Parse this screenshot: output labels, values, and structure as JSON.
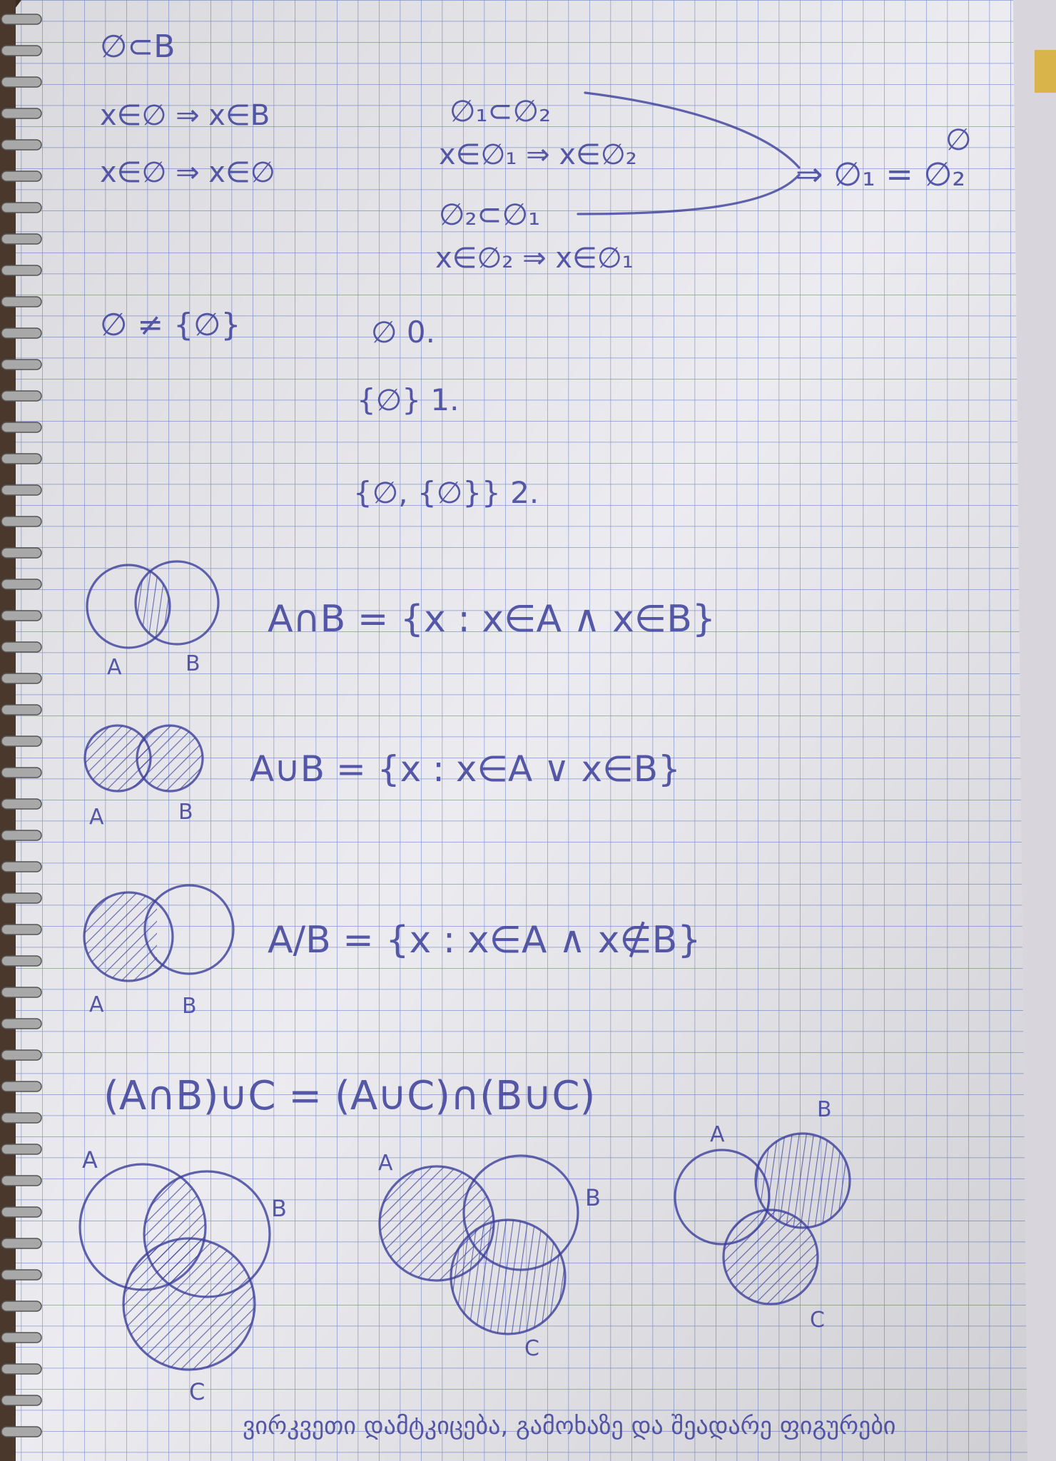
{
  "colors": {
    "paper": "#ecebf0",
    "grid": "#5a78c8",
    "ink": "#3c3f9a",
    "background": "#3a2a20",
    "binding": "#9a9a9a"
  },
  "notes": {
    "line1": "∅⊂B",
    "line2": "x∈∅ ⇒ x∈B",
    "line3": "x∈∅ ⇒ x∈∅",
    "sub1": "∅₁⊂∅₂",
    "sub2": "x∈∅₁ ⇒ x∈∅₂",
    "sub3": "∅₂⊂∅₁",
    "sub4": "x∈∅₂ ⇒ x∈∅₁",
    "conclusion": "⇒ ∅₁ = ∅₂",
    "empty_symbol": "∅",
    "ne": "∅ ≠ {∅}",
    "c0": "∅ 0.",
    "c1": "{∅} 1.",
    "c2": "{∅, {∅}} 2.",
    "intersection": "A∩B = {x : x∈A ∧ x∈B}",
    "union": "A∪B = {x : x∈A ∨ x∈B}",
    "difference": "A/B = {x : x∈A ∧ x∉B}",
    "law": "(A∩B)∪C = (A∪C)∩(B∪C)",
    "footer": "ვირკვეთი დამტკიცება, გამოხაზე და შეადარე ფიგურები"
  },
  "venn_labels": {
    "a": "A",
    "b": "B",
    "c": "C"
  }
}
